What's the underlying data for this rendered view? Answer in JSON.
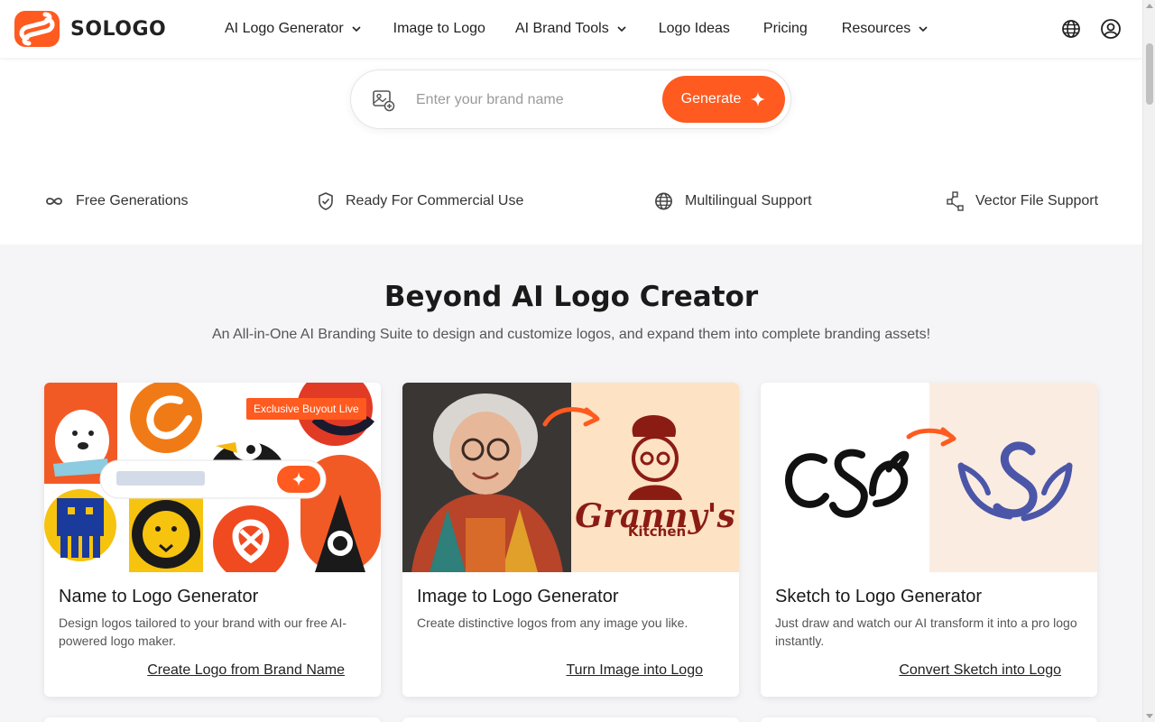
{
  "brand": {
    "name": "SOLOGO",
    "accent": "#ff5a1f"
  },
  "nav": {
    "items": [
      {
        "label": "AI Logo Generator",
        "dropdown": true
      },
      {
        "label": "Image to Logo",
        "dropdown": false
      },
      {
        "label": "AI Brand Tools",
        "dropdown": true
      },
      {
        "label": "Logo Ideas",
        "dropdown": false
      },
      {
        "label": "Pricing",
        "dropdown": false
      },
      {
        "label": "Resources",
        "dropdown": true
      }
    ],
    "icons": [
      "globe-icon",
      "user-account-icon"
    ]
  },
  "search": {
    "placeholder": "Enter your brand name",
    "value": "",
    "button_label": "Generate"
  },
  "features": [
    {
      "icon": "infinity-icon",
      "label": "Free Generations"
    },
    {
      "icon": "shield-check-icon",
      "label": "Ready For Commercial Use"
    },
    {
      "icon": "globe-icon",
      "label": "Multilingual Support"
    },
    {
      "icon": "vector-nodes-icon",
      "label": "Vector File Support"
    }
  ],
  "section": {
    "title": "Beyond AI Logo Creator",
    "subtitle": "An All-in-One AI Branding Suite to design and customize logos, and expand them into complete branding assets!"
  },
  "cards": [
    {
      "title": "Name to Logo Generator",
      "description": "Design logos tailored to your brand with our free AI-powered logo maker.",
      "link": "Create Logo from Brand Name",
      "badge": "Exclusive Buyout Live"
    },
    {
      "title": "Image to Logo Generator",
      "description": "Create distinctive logos from any image you like.",
      "link": "Turn Image into Logo",
      "image_text": {
        "line1": "Granny's",
        "line2": "Kitchen"
      }
    },
    {
      "title": "Sketch to Logo Generator",
      "description": "Just draw and watch our AI transform it into a pro logo instantly.",
      "link": "Convert Sketch into Logo"
    }
  ]
}
